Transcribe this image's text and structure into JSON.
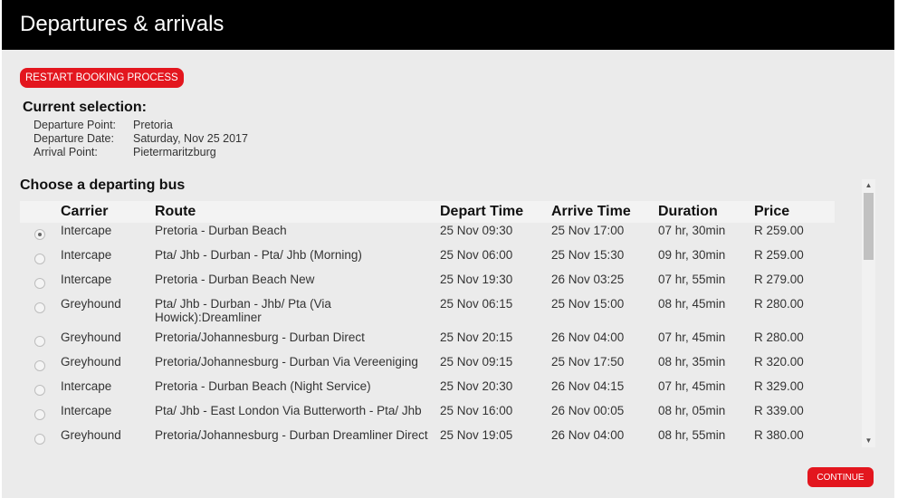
{
  "header": {
    "title": "Departures & arrivals"
  },
  "buttons": {
    "restart": "RESTART BOOKING PROCESS",
    "continue": "CONTINUE"
  },
  "selection": {
    "title": "Current selection:",
    "fields": [
      {
        "label": "Departure Point:",
        "value": "Pretoria"
      },
      {
        "label": "Departure Date:",
        "value": "Saturday, Nov 25 2017"
      },
      {
        "label": "Arrival Point:",
        "value": "Pietermaritzburg"
      }
    ]
  },
  "table": {
    "title": "Choose a departing bus",
    "columns": [
      "Carrier",
      "Route",
      "Depart Time",
      "Arrive Time",
      "Duration",
      "Price"
    ],
    "rows": [
      {
        "selected": true,
        "carrier": "Intercape",
        "route": [
          "Pretoria - Durban Beach"
        ],
        "depart": "25 Nov 09:30",
        "arrive": "25 Nov 17:00",
        "duration": "07 hr, 30min",
        "price": "R 259.00"
      },
      {
        "selected": false,
        "carrier": "Intercape",
        "route": [
          "Pta/ Jhb - Durban - Pta/ Jhb (Morning)"
        ],
        "depart": "25 Nov 06:00",
        "arrive": "25 Nov 15:30",
        "duration": "09 hr, 30min",
        "price": "R 259.00"
      },
      {
        "selected": false,
        "carrier": "Intercape",
        "route": [
          "Pretoria - Durban Beach New"
        ],
        "depart": "25 Nov 19:30",
        "arrive": "26 Nov 03:25",
        "duration": "07 hr, 55min",
        "price": "R 279.00"
      },
      {
        "selected": false,
        "carrier": "Greyhound",
        "route": [
          "Pta/ Jhb - Durban - Jhb/ Pta (Via",
          "Howick):Dreamliner"
        ],
        "depart": "25 Nov 06:15",
        "arrive": "25 Nov 15:00",
        "duration": "08 hr, 45min",
        "price": "R 280.00"
      },
      {
        "selected": false,
        "carrier": "Greyhound",
        "route": [
          "Pretoria/Johannesburg - Durban Direct"
        ],
        "depart": "25 Nov 20:15",
        "arrive": "26 Nov 04:00",
        "duration": "07 hr, 45min",
        "price": "R 280.00"
      },
      {
        "selected": false,
        "carrier": "Greyhound",
        "route": [
          "Pretoria/Johannesburg - Durban Via Vereeniging"
        ],
        "depart": "25 Nov 09:15",
        "arrive": "25 Nov 17:50",
        "duration": "08 hr, 35min",
        "price": "R 320.00"
      },
      {
        "selected": false,
        "carrier": "Intercape",
        "route": [
          "Pretoria - Durban Beach (Night Service)"
        ],
        "depart": "25 Nov 20:30",
        "arrive": "26 Nov 04:15",
        "duration": "07 hr, 45min",
        "price": "R 329.00"
      },
      {
        "selected": false,
        "carrier": "Intercape",
        "route": [
          "Pta/ Jhb - East London Via Butterworth - Pta/ Jhb"
        ],
        "depart": "25 Nov 16:00",
        "arrive": "26 Nov 00:05",
        "duration": "08 hr, 05min",
        "price": "R 339.00"
      },
      {
        "selected": false,
        "carrier": "Greyhound",
        "route": [
          "Pretoria/Johannesburg - Durban Dreamliner Direct"
        ],
        "depart": "25 Nov 19:05",
        "arrive": "26 Nov 04:00",
        "duration": "08 hr, 55min",
        "price": "R 380.00"
      }
    ]
  },
  "icons": {
    "radio": "radio-button-icon",
    "scroll_up": "scroll-up-arrow-icon",
    "scroll_down": "scroll-down-arrow-icon"
  },
  "colors": {
    "accent": "#e3161e",
    "header_bg": "#000000",
    "page_bg": "#ebebeb"
  }
}
